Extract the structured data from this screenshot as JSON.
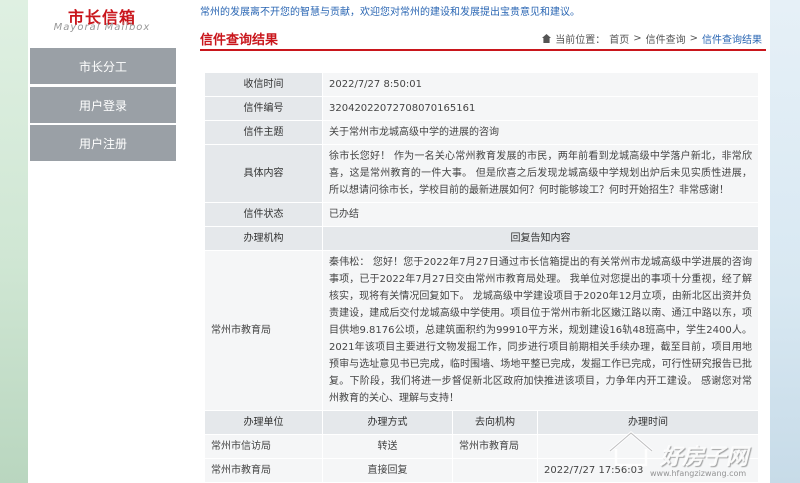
{
  "sidebar": {
    "title": "市长信箱",
    "subtitle": "Mayoral Mailbox",
    "items": [
      {
        "label": "市长分工"
      },
      {
        "label": "用户登录"
      },
      {
        "label": "用户注册"
      }
    ]
  },
  "header": {
    "marquee": "常州的发展离不开您的智慧与贡献，欢迎您对常州的建设和发展提出宝贵意见和建议。"
  },
  "section": {
    "title": "信件查询结果",
    "breadcrumb": {
      "prefix": "当前位置：",
      "home": "首页",
      "sep1": ">",
      "level2": "信件查询",
      "sep2": ">",
      "current": "信件查询结果"
    }
  },
  "letter": {
    "receive_time_label": "收信时间",
    "receive_time": "2022/7/27 8:50:01",
    "number_label": "信件编号",
    "number": "32042022072708070165161",
    "subject_label": "信件主题",
    "subject": "关于常州市龙城高级中学的进展的咨询",
    "content_label": "具体内容",
    "content": "徐市长您好！ 作为一名关心常州教育发展的市民，两年前看到龙城高级中学落户新北，非常欣喜，这是常州教育的一件大事。 但是欣喜之后发现龙城高级中学规划出炉后未见实质性进展，所以想请问徐市长，学校目前的最新进展如何？何时能够竣工？何时开始招生？非常感谢！",
    "status_label": "信件状态",
    "status": "已办结",
    "org_label": "办理机构",
    "reply_label": "回复告知内容",
    "org": "常州市教育局",
    "reply": "秦伟松： 您好！您于2022年7月27日通过市长信箱提出的有关常州市龙城高级中学进展的咨询事项，已于2022年7月27日交由常州市教育局处理。 我单位对您提出的事项十分重视，经了解核实，现将有关情况回复如下。 龙城高级中学建设项目于2020年12月立项，由新北区出资并负责建设，建成后交付龙城高级中学使用。项目位于常州市新北区嫩江路以南、通江中路以东，项目供地9.8176公顷，总建筑面积约为99910平方米，规划建设16轨48班高中，学生2400人。2021年该项目主要进行文物发掘工作，同步进行项目前期相关手续办理，截至目前，项目用地预审与选址意见书已完成，临时围墙、场地平整已完成，发掘工作已完成，可行性研究报告已批复。下阶段，我们将进一步督促新北区政府加快推进该项目，力争年内开工建设。 感谢您对常州教育的关心、理解与支持！"
  },
  "process": {
    "headers": [
      "办理单位",
      "办理方式",
      "去向机构",
      "办理时间"
    ],
    "rows": [
      {
        "unit": "常州市信访局",
        "method": "转送",
        "dest": "常州市教育局",
        "time": ""
      },
      {
        "unit": "常州市教育局",
        "method": "直接回复",
        "dest": "",
        "time": "2022/7/27 17:56:03"
      }
    ]
  },
  "watermark": {
    "text": "好房子网",
    "url": "www.hfangzizwang.com"
  },
  "colors": {
    "brand_red": "#c9161c",
    "link_blue": "#2a66b3",
    "nav_gray": "#9aa0a6",
    "label_bg": "#e5e8eb",
    "value_bg": "#f5f6f7"
  }
}
